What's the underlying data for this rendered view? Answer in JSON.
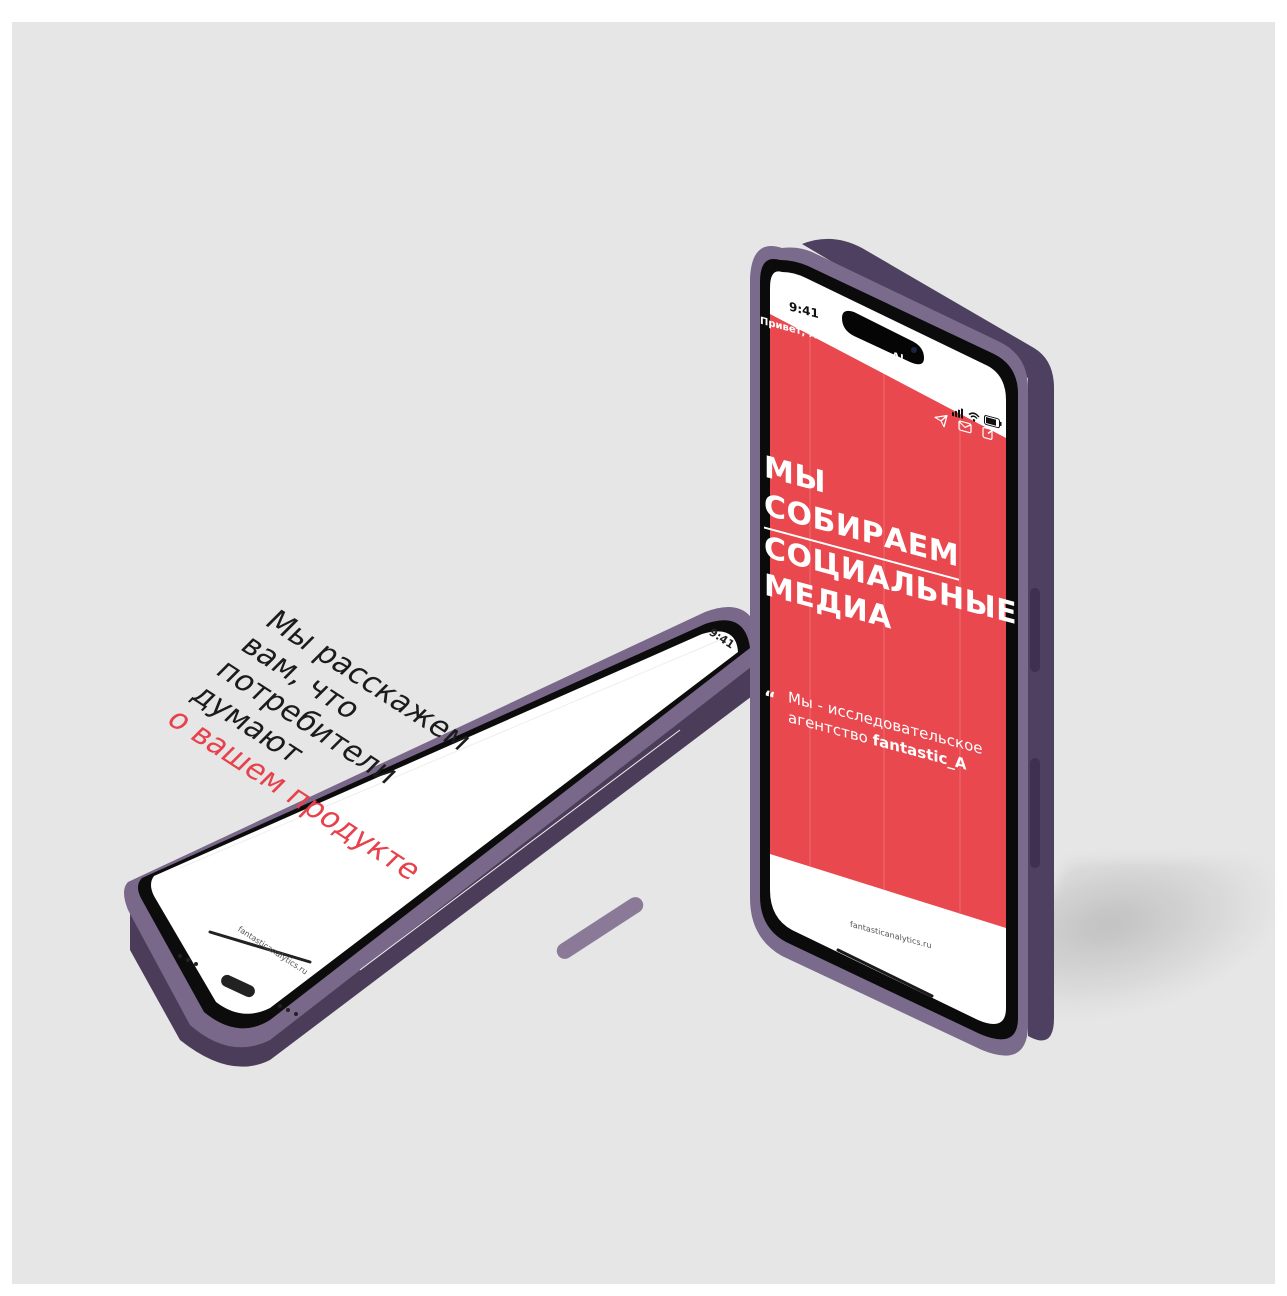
{
  "colors": {
    "backdrop": "#e6e6e6",
    "accent_red": "#e8414b",
    "phone_frame": "#6b5a78",
    "screen_white": "#ffffff",
    "text_dark": "#1b1b1b"
  },
  "lying_phone": {
    "time": "9:41",
    "text_lines": [
      "Мы расскажем",
      "вам, что",
      "потребители",
      "думают"
    ],
    "accent_line": "о вашем продукте",
    "url": "fantasticanalytics.ru"
  },
  "standing_phone": {
    "time": "9:41",
    "greeting": "Привет, мы - fantastic_A!",
    "icons": [
      "telegram-icon",
      "mail-icon",
      "edit-icon"
    ],
    "headline": [
      "МЫ",
      "СОБИРАЕМ",
      "СОЦИАЛЬНЫЕ",
      "МЕДИА"
    ],
    "quote_mark": "“",
    "quote_lines": [
      "Мы - исследовательское",
      "агентство"
    ],
    "quote_brand": "fantastic_A",
    "url": "fantasticanalytics.ru"
  }
}
